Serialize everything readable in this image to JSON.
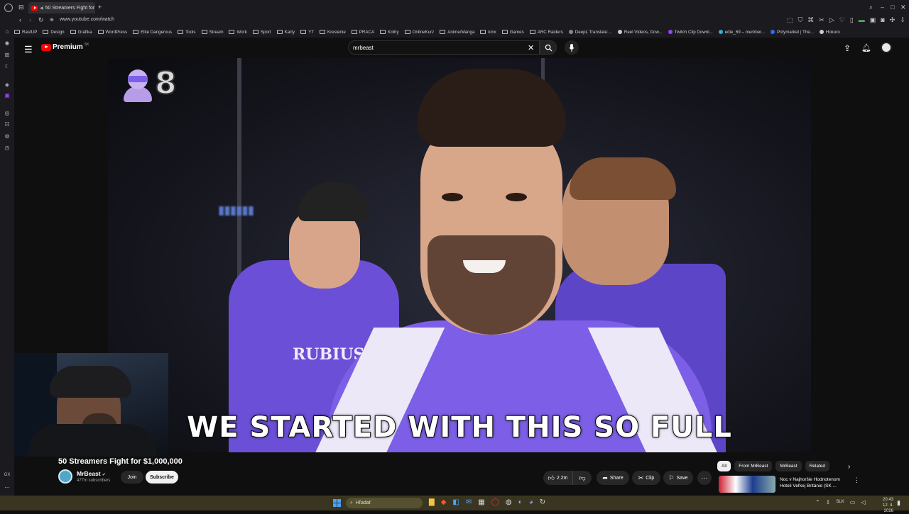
{
  "browser": {
    "tab_title": "50 Streamers Fight for",
    "url": "www.youtube.com/watch",
    "bookmarks": [
      "RastUP",
      "Design",
      "Grafika",
      "WordPress",
      "Elite Dangerous",
      "Tools",
      "Stream",
      "Work",
      "Sport",
      "Karty",
      "YT",
      "Kreslenie",
      "PRACA",
      "Knihy",
      "OnlineKurz",
      "Anime/Manga",
      "kmx",
      "Games",
      "ARC Raiders",
      "DeepL Translate:...",
      "Reel Videos, Dow...",
      "Twitch Clip Downl...",
      "edie_69 – member...",
      "Polymarket | The...",
      "Hokuro"
    ]
  },
  "youtube": {
    "logo_text": "Premium",
    "region": "SK",
    "search_value": "mrbeast",
    "subtitle": "WE STARTED WITH THIS SO FULL",
    "overlay_number": "8",
    "video_title": "50 Streamers Fight for $1,000,000",
    "channel_name": "MrBeast",
    "subscribers": "477m subscribers",
    "join_label": "Join",
    "subscribe_label": "Subscribe",
    "like_count": "2.2m",
    "share_label": "Share",
    "clip_label": "Clip",
    "save_label": "Save",
    "chips": [
      "All",
      "From MrBeast",
      "MrBeast",
      "Related"
    ],
    "related": {
      "title_line1": "Noc v Najhoršie Hodnotenom",
      "title_line2": "Hoteli Veľkej Británie (SK ..."
    },
    "jersey_text": "RUBIUS"
  },
  "taskbar": {
    "search_placeholder": "Hľadať",
    "lang": "SLK",
    "time": "20:43",
    "date": "12. 4. 2026"
  },
  "sidebar_footer": "GX",
  "colors": {
    "accent_red": "#ff0000",
    "jersey_purple": "#7a5be0",
    "taskbar": "#3a3520"
  }
}
